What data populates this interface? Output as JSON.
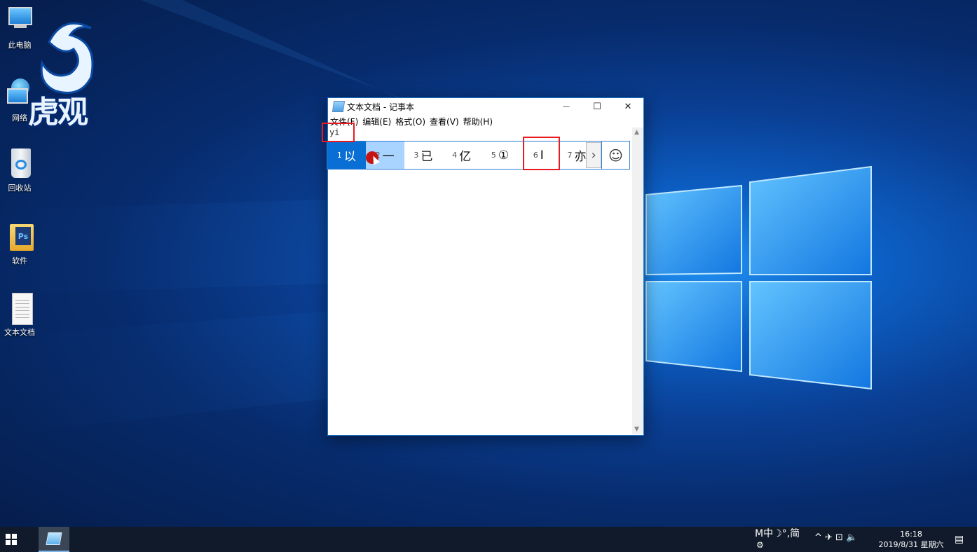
{
  "desktop": {
    "icons": [
      {
        "label": "此电脑",
        "icon": "computer-icon"
      },
      {
        "label": "网络",
        "icon": "network-icon"
      },
      {
        "label": "回收站",
        "icon": "recycle-bin-icon"
      },
      {
        "label": "软件",
        "icon": "folder-icon"
      },
      {
        "label": "文本文档",
        "icon": "text-document-icon"
      }
    ],
    "watermark": "虎观"
  },
  "notepad": {
    "title": "文本文档 - 记事本",
    "menu": [
      "文件(F)",
      "编辑(E)",
      "格式(O)",
      "查看(V)",
      "帮助(H)"
    ],
    "typed_text": "yi",
    "buttons": {
      "minimize": "—",
      "maximize": "☐",
      "close": "✕"
    }
  },
  "ime": {
    "candidates": [
      {
        "num": "1",
        "text": "以"
      },
      {
        "num": "2",
        "text": "一"
      },
      {
        "num": "3",
        "text": "已"
      },
      {
        "num": "4",
        "text": "亿"
      },
      {
        "num": "5",
        "text": "①"
      },
      {
        "num": "6",
        "text": "Ⅰ"
      },
      {
        "num": "7",
        "text": "亦"
      }
    ],
    "selected_index": 0,
    "more": "›",
    "emoji": "☺"
  },
  "taskbar": {
    "ime_indicator": "M中☽°,简",
    "tray_icons": "^  ✈  ⊡  🔈",
    "time": "16:18",
    "date": "2019/8/31 星期六",
    "colors": {
      "bar": "#101a2a",
      "accent": "#0a6fd4"
    }
  }
}
